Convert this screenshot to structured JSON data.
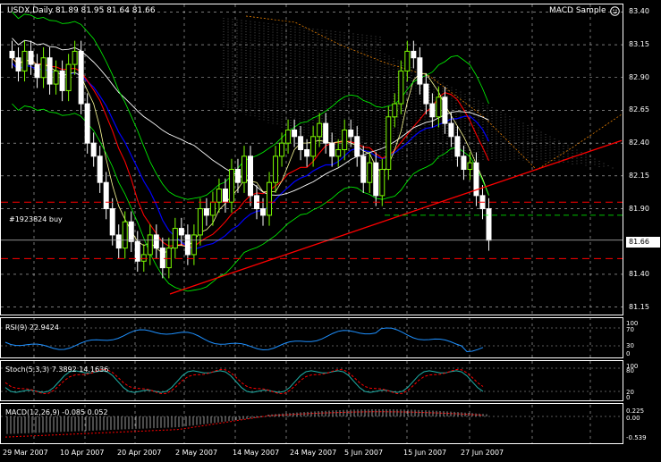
{
  "header": {
    "symbol": "USDX,Daily",
    "ohlc": "81.89 81.95 81.64 81.66",
    "expert": "MACD Sample"
  },
  "trade_label": "#1923824 buy",
  "current_price": "81.66",
  "panels": {
    "rsi": {
      "title": "RSI(9) 22.9424",
      "levels": [
        "100",
        "70",
        "30",
        "0"
      ]
    },
    "stoch": {
      "title": "Stoch(5,3,3) 7.3892 14.1636",
      "levels": [
        "100",
        "80",
        "20",
        "0"
      ]
    },
    "macd": {
      "title": "MACD(12,26,9) -0.085 0.052",
      "levels": [
        "0.225",
        "0.00",
        "-0.539"
      ]
    }
  },
  "colors": {
    "background": "#000000",
    "grid": "#ffffff",
    "bull_candle": "#7cfc00",
    "bear_candle": "#ffffff",
    "trendline": "#ff0000",
    "ma_blue": "#0000ff",
    "ma_red": "#ff0000",
    "ma_white": "#ffffff",
    "bollinger": "#00ff00",
    "rsi_line": "#1e90ff",
    "stoch_main": "#20b2aa",
    "stoch_signal": "#ff0000",
    "macd_hist": "#c0c0c0",
    "macd_signal": "#ff0000"
  },
  "chart_data": {
    "type": "candlestick",
    "symbol": "USDX",
    "timeframe": "Daily",
    "y_ticks": [
      "83.40",
      "83.15",
      "82.90",
      "82.65",
      "82.40",
      "82.15",
      "81.90",
      "81.66",
      "81.40",
      "81.15"
    ],
    "ylim": [
      81.1,
      83.45
    ],
    "x_ticks": [
      "29 Mar 2007",
      "10 Apr 2007",
      "20 Apr 2007",
      "2 May 2007",
      "14 May 2007",
      "24 May 2007",
      "5 Jun 2007",
      "15 Jun 2007",
      "27 Jun 2007"
    ],
    "grid": true,
    "candles_close": [
      83.05,
      82.95,
      83.1,
      83.0,
      82.9,
      83.05,
      82.85,
      82.95,
      82.8,
      83.0,
      83.1,
      82.7,
      82.4,
      82.3,
      82.1,
      81.9,
      81.7,
      81.6,
      81.8,
      81.65,
      81.5,
      81.55,
      81.7,
      81.6,
      81.45,
      81.6,
      81.75,
      81.7,
      81.55,
      81.7,
      81.9,
      81.85,
      81.95,
      82.05,
      81.95,
      82.2,
      82.1,
      82.3,
      82.0,
      81.9,
      81.85,
      82.1,
      82.3,
      82.4,
      82.5,
      82.45,
      82.35,
      82.3,
      82.45,
      82.55,
      82.4,
      82.3,
      82.35,
      82.5,
      82.45,
      82.3,
      82.1,
      82.25,
      82.0,
      82.2,
      82.6,
      82.7,
      82.95,
      83.1,
      83.05,
      82.85,
      82.7,
      82.6,
      82.75,
      82.55,
      82.45,
      82.3,
      82.2,
      82.25,
      82.0,
      81.9,
      81.66
    ],
    "projection_trendline": {
      "from": [
        "20 Apr 2007",
        81.25
      ],
      "to": [
        "29 Jun 2007",
        82.4
      ]
    },
    "horizontal_levels": [
      81.95,
      81.52,
      81.85
    ]
  }
}
